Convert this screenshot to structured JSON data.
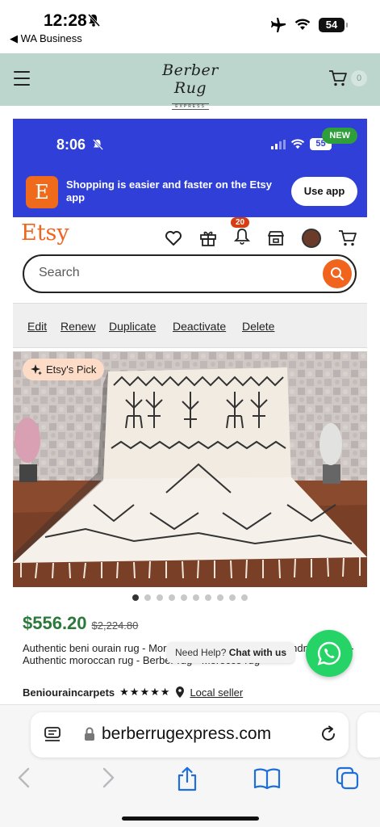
{
  "status_bar": {
    "time": "12:28",
    "back_app": "◀ WA Business",
    "battery": "54"
  },
  "site_header": {
    "logo_script": "Berber Rug",
    "logo_sub": "EXPRESS",
    "cart_count": "0"
  },
  "embedded": {
    "status_time": "8:06",
    "battery": "55",
    "new_badge": "NEW",
    "app_banner": {
      "logo_letter": "E",
      "text": "Shopping is easier and faster on the Etsy app",
      "button": "Use app"
    },
    "etsy_logo": "Etsy",
    "notification_count": "20",
    "search_placeholder": "Search",
    "actions": [
      "Edit",
      "Renew",
      "Duplicate",
      "Deactivate",
      "Delete"
    ],
    "badge": "Etsy's Pick",
    "price": "$556.20",
    "old_price": "$2,224.80",
    "title": "Authentic beni ourain rug - Moroccan Beni ourain rug - Handmade rug - Authentic moroccan rug - Berber rug - Morocco rug",
    "shop": "Beniouraincarpets",
    "stars": "★★★★★",
    "local_seller": "Local seller",
    "dots_total": 10,
    "dots_active_index": 0
  },
  "chat": {
    "prefix": "Need Help? ",
    "bold": "Chat with us"
  },
  "safari": {
    "url": "berberrugexpress.com"
  },
  "colors": {
    "header_bg": "#bcd6cd",
    "etsy_blue": "#2f3fd8",
    "etsy_orange": "#f1641e",
    "price_green": "#2b7a3b",
    "whatsapp_green": "#25d366"
  }
}
